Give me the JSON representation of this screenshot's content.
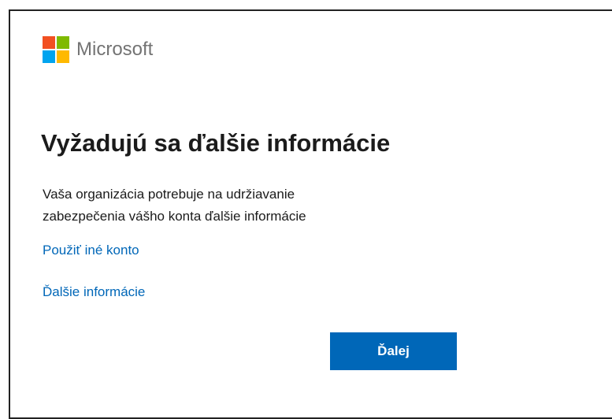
{
  "brand": {
    "name": "Microsoft",
    "icon": "microsoft-logo-icon",
    "colors": {
      "red": "#f25022",
      "green": "#7fba00",
      "blue": "#00a4ef",
      "yellow": "#ffb900",
      "text": "#737373"
    }
  },
  "main": {
    "title": "Vyžadujú sa ďalšie informácie",
    "description_line1": "Vaša organizácia potrebuje na udržiavanie",
    "description_line2": "zabezpečenia vášho konta ďalšie informácie",
    "use_other_account_link": "Použiť iné konto",
    "more_info_link": "Ďalšie informácie",
    "next_button": "Ďalej"
  },
  "colors": {
    "accent": "#0067b8",
    "text": "#1b1b1b",
    "border": "#222222"
  }
}
